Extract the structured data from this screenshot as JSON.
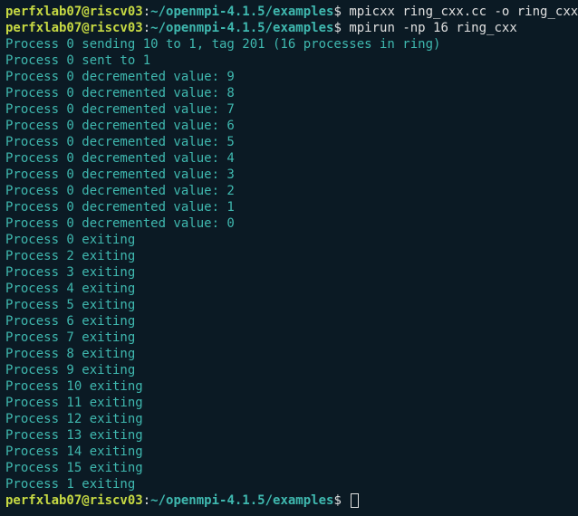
{
  "prompts": [
    {
      "user_host": "perfxlab07@riscv03",
      "colon": ":",
      "path": "~/openmpi-4.1.5/examples",
      "dollar": "$ ",
      "cmd": "mpicxx ring_cxx.cc -o ring_cxx"
    },
    {
      "user_host": "perfxlab07@riscv03",
      "colon": ":",
      "path": "~/openmpi-4.1.5/examples",
      "dollar": "$ ",
      "cmd": "mpirun -np 16 ring_cxx"
    }
  ],
  "output": [
    "Process 0 sending 10 to 1, tag 201 (16 processes in ring)",
    "Process 0 sent to 1",
    "Process 0 decremented value: 9",
    "Process 0 decremented value: 8",
    "Process 0 decremented value: 7",
    "Process 0 decremented value: 6",
    "Process 0 decremented value: 5",
    "Process 0 decremented value: 4",
    "Process 0 decremented value: 3",
    "Process 0 decremented value: 2",
    "Process 0 decremented value: 1",
    "Process 0 decremented value: 0",
    "Process 0 exiting",
    "Process 2 exiting",
    "Process 3 exiting",
    "Process 4 exiting",
    "Process 5 exiting",
    "Process 6 exiting",
    "Process 7 exiting",
    "Process 8 exiting",
    "Process 9 exiting",
    "Process 10 exiting",
    "Process 11 exiting",
    "Process 12 exiting",
    "Process 13 exiting",
    "Process 14 exiting",
    "Process 15 exiting",
    "Process 1 exiting"
  ],
  "final_prompt": {
    "user_host": "perfxlab07@riscv03",
    "colon": ":",
    "path": "~/openmpi-4.1.5/examples",
    "dollar": "$ "
  }
}
